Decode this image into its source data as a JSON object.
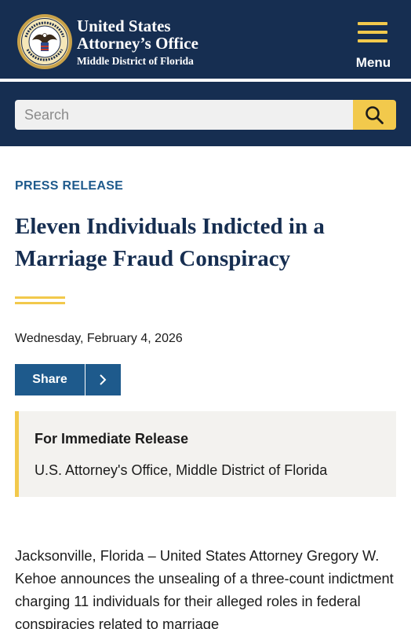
{
  "header": {
    "title_line1": "United States",
    "title_line2": "Attorney’s Office",
    "subtitle": "Middle District of Florida",
    "menu_label": "Menu",
    "seal_text": "DEPARTMENT OF JUSTICE"
  },
  "search": {
    "placeholder": "Search",
    "icon": "search-icon"
  },
  "article": {
    "eyebrow": "PRESS RELEASE",
    "title": "Eleven Individuals Indicted in a Marriage Fraud Conspiracy",
    "date": "Wednesday, February 4, 2026",
    "share_label": "Share",
    "share_toggle_icon": "chevron-right-icon",
    "notice_title": "For Immediate Release",
    "notice_office": "U.S. Attorney's Office, Middle District of Florida",
    "body_visible": "Jacksonville, Florida – United States Attorney Gregory W. Kehoe announces the  unsealing of a three-count indictment charging 11 individuals for their alleged roles in federal conspiracies related to marriage"
  },
  "colors": {
    "navy": "#162e51",
    "gold": "#f2c94c",
    "link_blue": "#1e5a8c",
    "panel_bg": "#f3f2ef"
  }
}
